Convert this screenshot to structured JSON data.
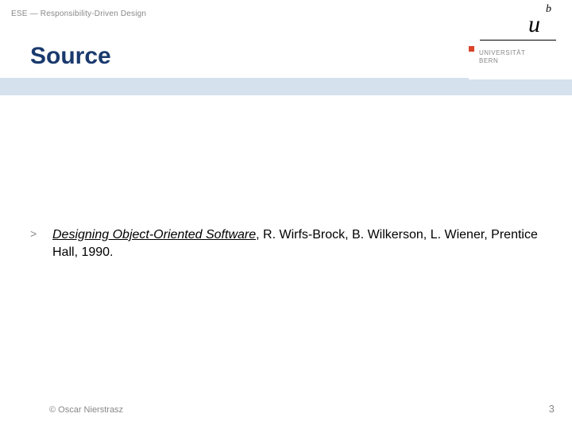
{
  "header": {
    "course_line": "ESE — Responsibility-Driven Design"
  },
  "title": "Source",
  "logo": {
    "u": "u",
    "b": "b",
    "uni_line1": "UNIVERSITÄT",
    "uni_line2": "BERN"
  },
  "content": {
    "bullet_marker": ">",
    "book_title": "Designing Object-Oriented Software",
    "citation_rest": ", R. Wirfs-Brock, B. Wilkerson, L. Wiener, Prentice Hall, 1990."
  },
  "footer": {
    "copyright": "© Oscar Nierstrasz",
    "page_number": "3"
  }
}
